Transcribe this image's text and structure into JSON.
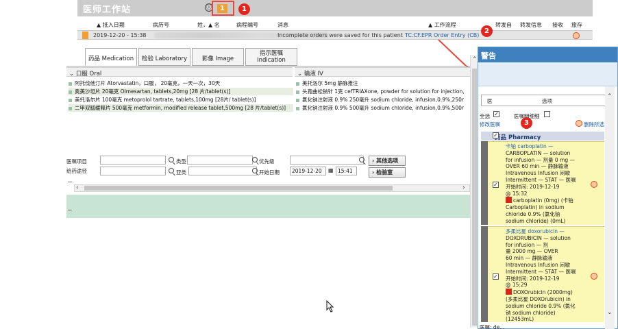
{
  "topbar": {
    "title": "医师工作站",
    "info": "ⓘ",
    "count": "1"
  },
  "callouts": [
    "1",
    "2",
    "3"
  ],
  "list_header": {
    "arrival": "▲ 抵入日期",
    "record": "病历号",
    "name": "姓，▲ 名",
    "case": "病程编号",
    "msg": "消息",
    "workflow": "▲ 工作流程",
    "transfer_from": "转发自",
    "transfer_info": "转发信息",
    "received": "接收",
    "archive": "旅存"
  },
  "patient": {
    "date": "2019-12-20 - 15:38",
    "message": "Incomplete orders were saved for this patient",
    "workflow": "TC.CF.EPR Order Entry (CB)"
  },
  "tabs": [
    "药品 Medication",
    "检验 Laboratory",
    "影像 Image",
    "指示医嘱\nIndication"
  ],
  "sections": {
    "oral": "口服 Oral",
    "iv": "输液 IV"
  },
  "oral_orders": [
    "阿托伐他汀片 Atorvastatin，口服， 20毫克，一天一次，30天",
    "奥美沙坦片 20毫克 Olmesartan, tablets,20mg [28 片/tablet(s)]",
    "美托洛尔片 100毫克 metoprolol tartrate, tablets,100mg [28片/ tablet(s)]",
    "二甲双胍缓释片 500毫克 metformin, modified release tablet,500mg [28 片/tablet(s)]"
  ],
  "iv_orders": [
    "美托洛尔 5mg 静脉推注",
    "头孢曲松钠针 1克 cefTRIAXone, powder for solution for injection,",
    "氯化钠注射液 0.9% 250毫升 sodium chloride, infusion,0.9%,250r",
    "氯化钠注射液 0.9% 500毫升 sodium chloride, infusion,0.9%,500r"
  ],
  "form": {
    "order_item": "医嘱项目",
    "route": "给药途径",
    "type": "类型",
    "subtype": "亚类",
    "priority": "优先级",
    "start_date_label": "开始日期",
    "start_date": "2019-12-20",
    "start_time": "15:41",
    "other_options": "其他选项",
    "lab": "检验室"
  },
  "alerts": {
    "title": "警告",
    "order_label": "医",
    "options": "选项",
    "select_all": "全选",
    "show_details": "医嘱明细细",
    "modify_order": "修改医嘱",
    "delete_selected": "删除所选",
    "category": "药品 Pharmacy",
    "cards": [
      {
        "drug": "卡铂 carboplatin —",
        "l1": "CARBOPLATIN — solution",
        "l2": "for infusion — 剂量 0 mg —",
        "l3": "OVER 60 min — 静脉输液",
        "l4": "Intravenous Infusion 间歇",
        "l5": "Intermittent — STAT — 医嘱",
        "l6": "开始时间: 2019-12-19",
        "l7": "@ 15:32",
        "l8": "carboplatin (0mg) (卡铂",
        "l9": "Carboplatin) in sodium",
        "l10": "chloride 0.9% (氯化钠",
        "l11": "sodium chloride) (0mL)"
      },
      {
        "drug": "多柔比星 doxorubicin —",
        "l1": "DOXORUBICIN — solution",
        "l2": "for infusion — 剂",
        "l3": "量 2000 mg — OVER",
        "l4": "60 min — 静脉输液",
        "l5": "Intravenous Infusion 间歇",
        "l6": "Intermittent — STAT — 医嘱",
        "l7": "开始时间: 2019-12-19",
        "l8": "@ 15:29",
        "l9": "DOXOrubicin (2000mg)",
        "l10": "(多柔比星 DOXOrubicin) in",
        "l11": "sodium chloride 0.9% (氯化",
        "l12": "钠 sodium chloride)",
        "l13": "(12453mL)"
      }
    ],
    "footer": "医嘱: de..."
  }
}
